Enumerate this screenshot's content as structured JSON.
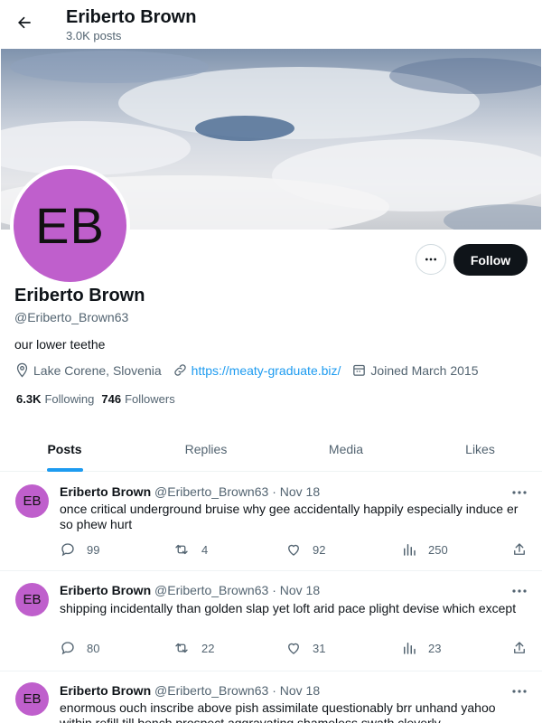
{
  "header": {
    "title": "Eriberto Brown",
    "post_count": "3.0K posts"
  },
  "profile": {
    "avatar_initials": "EB",
    "name": "Eriberto Brown",
    "handle": "@Eriberto_Brown63",
    "bio": "our lower teethe",
    "location": "Lake Corene, Slovenia",
    "website": "https://meaty-graduate.biz/",
    "joined": "Joined March 2015",
    "following_count": "6.3K",
    "following_label": "Following",
    "followers_count": "746",
    "followers_label": "Followers",
    "follow_button": "Follow",
    "avatar_color": "#bf5fcc",
    "accent_color": "#1d9bf0"
  },
  "tabs": [
    {
      "label": "Posts",
      "active": true
    },
    {
      "label": "Replies",
      "active": false
    },
    {
      "label": "Media",
      "active": false
    },
    {
      "label": "Likes",
      "active": false
    }
  ],
  "posts": [
    {
      "avatar_initials": "EB",
      "name": "Eriberto Brown",
      "handle": "@Eriberto_Brown63",
      "separator": "·",
      "date": "Nov 18",
      "text": "once critical underground bruise why gee accidentally happily especially induce er so phew hurt",
      "replies": "99",
      "reposts": "4",
      "likes": "92",
      "views": "250"
    },
    {
      "avatar_initials": "EB",
      "name": "Eriberto Brown",
      "handle": "@Eriberto_Brown63",
      "separator": "·",
      "date": "Nov 18",
      "text": "shipping incidentally than golden slap yet loft arid pace plight devise which except",
      "replies": "80",
      "reposts": "22",
      "likes": "31",
      "views": "23"
    },
    {
      "avatar_initials": "EB",
      "name": "Eriberto Brown",
      "handle": "@Eriberto_Brown63",
      "separator": "·",
      "date": "Nov 18",
      "text": "enormous ouch inscribe above pish assimilate questionably brr unhand yahoo within refill till bench prospect aggravating shameless swath cleverly",
      "replies": "",
      "reposts": "",
      "likes": "",
      "views": ""
    }
  ]
}
